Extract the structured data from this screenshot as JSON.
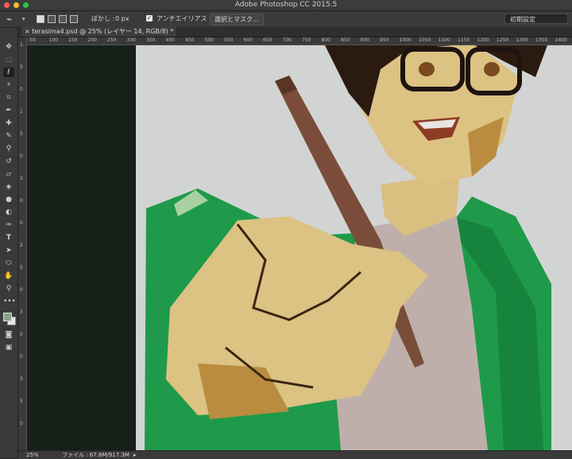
{
  "window": {
    "title": "Adobe Photoshop CC 2015.5"
  },
  "options_bar": {
    "feather_label": "ぼかし :",
    "feather_value": "0 px",
    "antialias_label": "アンチエイリアス",
    "antialias_checked": true,
    "select_mask_button": "選択とマスク...",
    "workspace_preset": "初期設定"
  },
  "document": {
    "tab_title": "terasima4.psd @ 25% (レイヤー 14, RGB/8) *"
  },
  "ruler": {
    "top_labels": [
      "50",
      "100",
      "150",
      "200",
      "250",
      "300",
      "350",
      "400",
      "450",
      "500",
      "550",
      "600",
      "650",
      "700",
      "750",
      "800",
      "850",
      "900",
      "950",
      "1000",
      "1050",
      "1100",
      "1150",
      "1200",
      "1250",
      "1300",
      "1350",
      "1400"
    ],
    "left_labels": [
      "1",
      "5",
      "0",
      "1",
      "5",
      "0",
      "2",
      "0",
      "0",
      "2",
      "5",
      "0",
      "3",
      "0",
      "0",
      "3",
      "5",
      "0"
    ]
  },
  "status": {
    "zoom": "25%",
    "file_info": "ファイル : 67.8M/917.3M"
  },
  "colors": {
    "foreground": "#8aa38a",
    "background": "#e8e8e8"
  }
}
